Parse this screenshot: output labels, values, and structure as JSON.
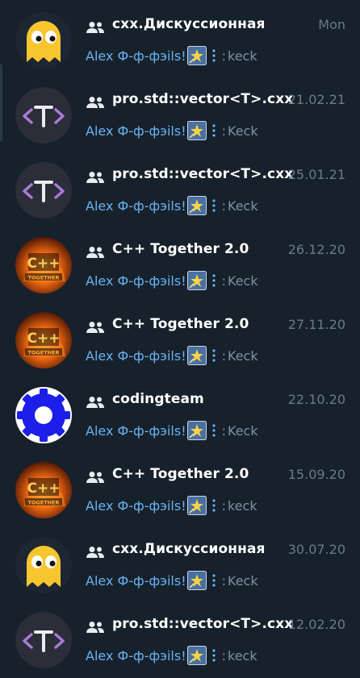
{
  "colors": {
    "background": "#17212b",
    "title": "#ffffff",
    "date": "#6b7a8a",
    "sender": "#6ab3f3",
    "message": "#7f91a4"
  },
  "chats": [
    {
      "avatar": "pacman-ghost-avatar",
      "title": "cxx.Дискуссионная",
      "date": "Mon",
      "sender": "Alex Ф-ф-фэіls!",
      "text": "keck"
    },
    {
      "avatar": "template-t-avatar",
      "title": "pro.std::vector<T>.cxx",
      "date": "21.02.21",
      "sender": "Alex Ф-ф-фэіls!",
      "text": "Keck"
    },
    {
      "avatar": "template-t-avatar",
      "title": "pro.std::vector<T>.cxx",
      "date": "25.01.21",
      "sender": "Alex Ф-ф-фэіls!",
      "text": "Keck"
    },
    {
      "avatar": "cpp-together-fire-avatar",
      "title": "C++ Together 2.0",
      "date": "26.12.20",
      "sender": "Alex Ф-ф-фэіls!",
      "text": "Keck"
    },
    {
      "avatar": "cpp-together-fire-avatar",
      "title": "C++ Together 2.0",
      "date": "27.11.20",
      "sender": "Alex Ф-ф-фэіls!",
      "text": "Keck"
    },
    {
      "avatar": "gear-avatar",
      "title": "codingteam",
      "date": "22.10.20",
      "sender": "Alex Ф-ф-фэіls!",
      "text": "Keck"
    },
    {
      "avatar": "cpp-together-fire-avatar",
      "title": "C++ Together 2.0",
      "date": "15.09.20",
      "sender": "Alex Ф-ф-фэіls!",
      "text": "keck"
    },
    {
      "avatar": "pacman-ghost-avatar",
      "title": "cxx.Дискуссионная",
      "date": "30.07.20",
      "sender": "Alex Ф-ф-фэіls!",
      "text": "Keck"
    },
    {
      "avatar": "template-t-avatar",
      "title": "pro.std::vector<T>.cxx",
      "date": "12.02.20",
      "sender": "Alex Ф-ф-фэіls!",
      "text": "keck"
    }
  ]
}
